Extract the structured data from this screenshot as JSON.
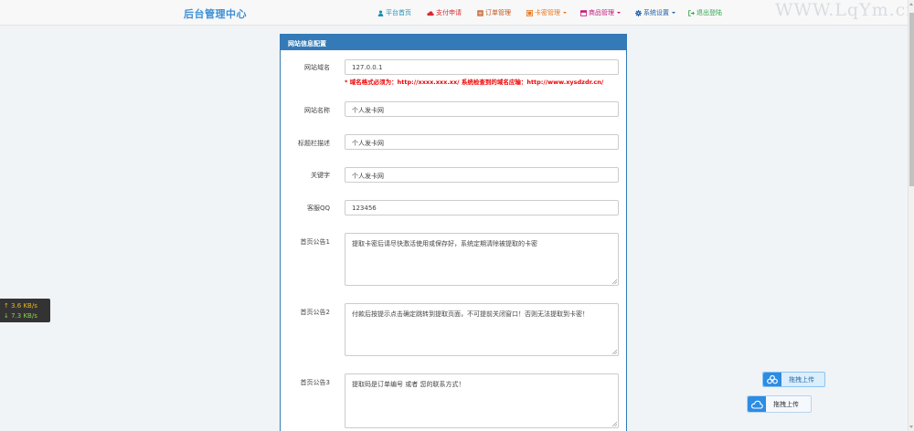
{
  "header": {
    "brand": "后台管理中心",
    "watermark": "WWW.LqYm.cn",
    "nav": [
      {
        "label": "平台首页",
        "color": "#1a8fb8",
        "icon": "user-icon",
        "dropdown": false
      },
      {
        "label": "支付申请",
        "color": "#d9282f",
        "icon": "cloud-icon",
        "dropdown": false
      },
      {
        "label": "订单管理",
        "color": "#c0541a",
        "icon": "list-icon",
        "dropdown": false
      },
      {
        "label": "卡密管理",
        "color": "#e8761e",
        "icon": "card-icon",
        "dropdown": true
      },
      {
        "label": "商品管理",
        "color": "#c2177a",
        "icon": "box-icon",
        "dropdown": true
      },
      {
        "label": "系统设置",
        "color": "#1f5fa8",
        "icon": "gear-icon",
        "dropdown": true
      },
      {
        "label": "退出登陆",
        "color": "#2ea44a",
        "icon": "logout-icon",
        "dropdown": false
      }
    ]
  },
  "panel": {
    "title": "网站信息配置",
    "accent": "#337ab7",
    "fields": [
      {
        "label": "网站域名",
        "value": "127.0.0.1"
      },
      {
        "label": "网站名称",
        "value": "个人发卡网"
      },
      {
        "label": "标题栏描述",
        "value": "个人发卡网"
      },
      {
        "label": "关键字",
        "value": "个人发卡网"
      },
      {
        "label": "客服QQ",
        "value": "123456"
      }
    ],
    "domain_hint": "* 域名格式必须为：http://xxxx.xxx.xx/ 系统检查到的域名应输：http://www.xysdzdr.cn/",
    "notices": [
      {
        "label": "首页公告1",
        "value": "提取卡密后请尽快激活使用或保存好，系统定期清除被提取的卡密"
      },
      {
        "label": "首页公告2",
        "value": "付款后按提示点击确定跳转到提取页面，不可提前关闭窗口！否则无法提取到卡密！"
      },
      {
        "label": "首页公告3",
        "value": "提取码是订单编号 或者 您的联系方式！"
      }
    ]
  },
  "speed_widget": {
    "up": "↑ 3.6 KB/s",
    "down": "↓ 7.3 KB/s"
  },
  "upload_buttons": [
    "拖拽上传",
    "拖拽上传"
  ]
}
